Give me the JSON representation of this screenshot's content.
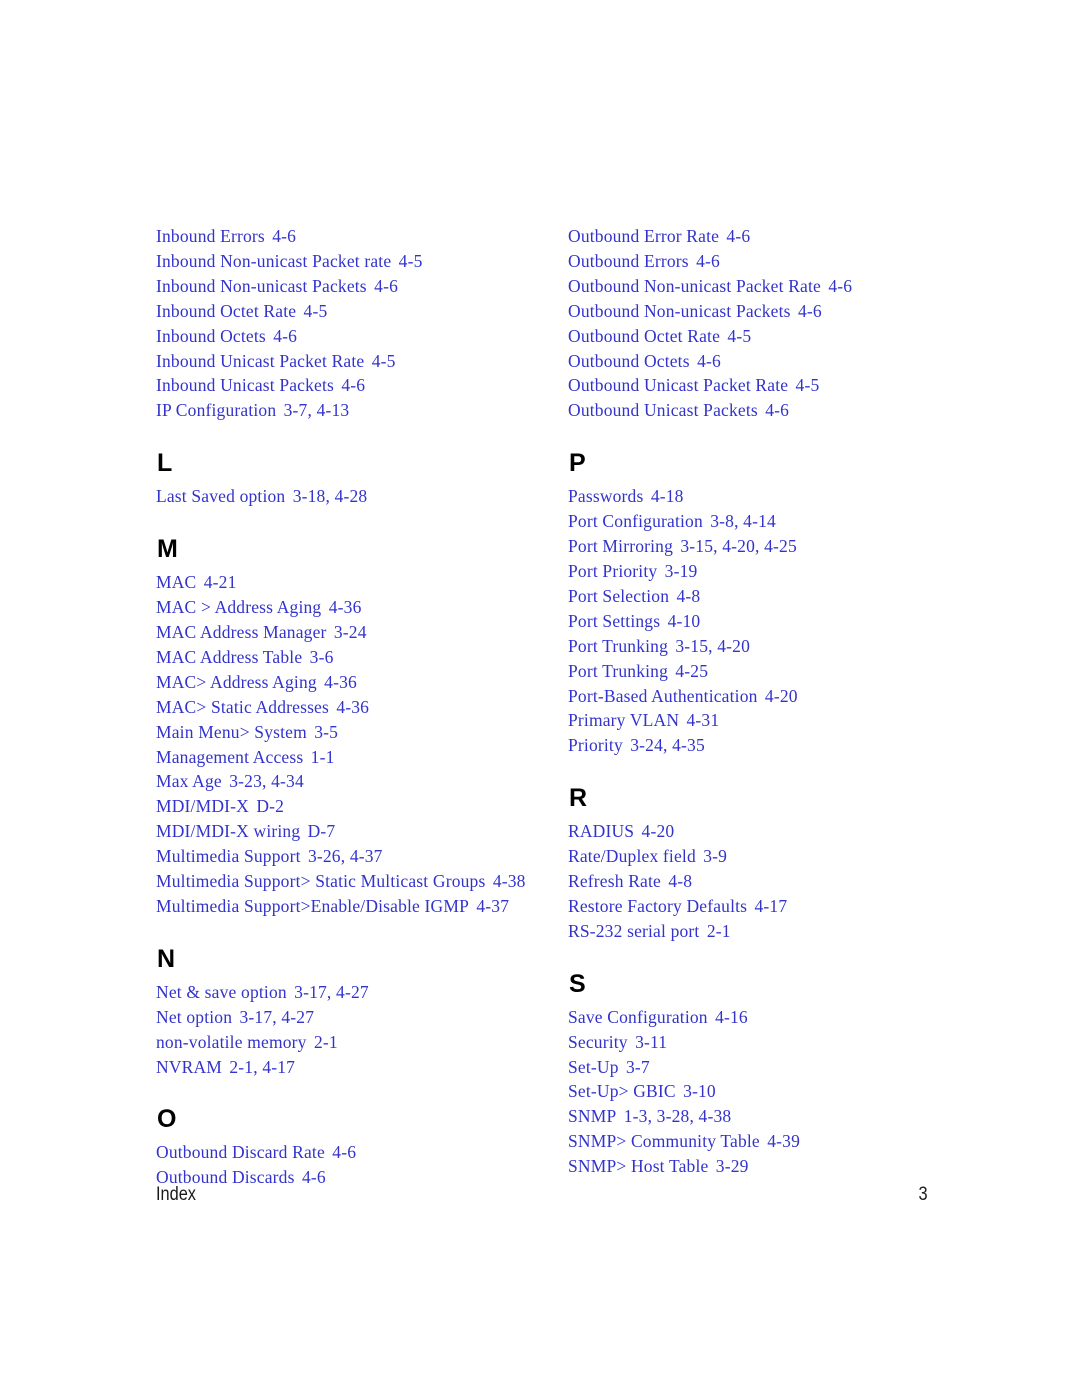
{
  "document": {
    "type": "index",
    "footer": {
      "label": "Index",
      "page_number": "3"
    },
    "text_color": "#3333cc",
    "heading_color": "#000000"
  },
  "columns": [
    {
      "name": "left",
      "sections": [
        {
          "letter": "",
          "entries": [
            {
              "term": "Inbound Errors",
              "loc": "4-6"
            },
            {
              "term": "Inbound Non-unicast Packet rate",
              "loc": "4-5"
            },
            {
              "term": "Inbound Non-unicast Packets",
              "loc": "4-6"
            },
            {
              "term": "Inbound Octet Rate",
              "loc": "4-5"
            },
            {
              "term": "Inbound Octets",
              "loc": "4-6"
            },
            {
              "term": "Inbound Unicast Packet Rate",
              "loc": "4-5"
            },
            {
              "term": "Inbound Unicast Packets",
              "loc": "4-6"
            },
            {
              "term": "IP Configuration",
              "loc": "3-7, 4-13"
            }
          ]
        },
        {
          "letter": "L",
          "entries": [
            {
              "term": "Last Saved option",
              "loc": "3-18, 4-28"
            }
          ]
        },
        {
          "letter": "M",
          "entries": [
            {
              "term": "MAC",
              "loc": "4-21"
            },
            {
              "term": "MAC > Address Aging",
              "loc": "4-36"
            },
            {
              "term": "MAC Address Manager",
              "loc": "3-24"
            },
            {
              "term": "MAC Address Table",
              "loc": "3-6"
            },
            {
              "term": "MAC> Address Aging",
              "loc": "4-36"
            },
            {
              "term": "MAC> Static Addresses",
              "loc": "4-36"
            },
            {
              "term": "Main Menu> System",
              "loc": "3-5"
            },
            {
              "term": "Management Access",
              "loc": "1-1"
            },
            {
              "term": "Max Age",
              "loc": "3-23, 4-34"
            },
            {
              "term": "MDI/MDI-X",
              "loc": "D-2"
            },
            {
              "term": "MDI/MDI-X wiring",
              "loc": "D-7"
            },
            {
              "term": "Multimedia Support",
              "loc": "3-26, 4-37"
            },
            {
              "term": "Multimedia Support> Static Multicast Groups",
              "loc": "4-38"
            },
            {
              "term": "Multimedia Support>Enable/Disable IGMP",
              "loc": "4-37"
            }
          ]
        },
        {
          "letter": "N",
          "entries": [
            {
              "term": "Net & save option",
              "loc": "3-17, 4-27"
            },
            {
              "term": "Net option",
              "loc": "3-17, 4-27"
            },
            {
              "term": "non-volatile memory",
              "loc": "2-1"
            },
            {
              "term": "NVRAM",
              "loc": "2-1, 4-17"
            }
          ]
        },
        {
          "letter": "O",
          "entries": [
            {
              "term": "Outbound Discard Rate",
              "loc": "4-6"
            },
            {
              "term": "Outbound Discards",
              "loc": "4-6"
            }
          ]
        }
      ]
    },
    {
      "name": "right",
      "sections": [
        {
          "letter": "",
          "entries": [
            {
              "term": "Outbound Error Rate",
              "loc": "4-6"
            },
            {
              "term": "Outbound Errors",
              "loc": "4-6"
            },
            {
              "term": "Outbound Non-unicast Packet Rate",
              "loc": "4-6"
            },
            {
              "term": "Outbound Non-unicast Packets",
              "loc": "4-6"
            },
            {
              "term": "Outbound Octet Rate",
              "loc": "4-5"
            },
            {
              "term": "Outbound Octets",
              "loc": "4-6"
            },
            {
              "term": "Outbound Unicast Packet Rate",
              "loc": "4-5"
            },
            {
              "term": "Outbound Unicast Packets",
              "loc": "4-6"
            }
          ]
        },
        {
          "letter": "P",
          "entries": [
            {
              "term": "Passwords",
              "loc": "4-18"
            },
            {
              "term": "Port Configuration",
              "loc": "3-8, 4-14"
            },
            {
              "term": "Port Mirroring",
              "loc": "3-15, 4-20, 4-25"
            },
            {
              "term": "Port Priority",
              "loc": "3-19"
            },
            {
              "term": "Port Selection",
              "loc": "4-8"
            },
            {
              "term": "Port Settings",
              "loc": "4-10"
            },
            {
              "term": "Port Trunking",
              "loc": "3-15, 4-20"
            },
            {
              "term": "Port Trunking",
              "loc": "4-25"
            },
            {
              "term": "Port-Based Authentication",
              "loc": "4-20"
            },
            {
              "term": "Primary VLAN",
              "loc": "4-31"
            },
            {
              "term": "Priority",
              "loc": "3-24, 4-35"
            }
          ]
        },
        {
          "letter": "R",
          "entries": [
            {
              "term": "RADIUS",
              "loc": "4-20"
            },
            {
              "term": "Rate/Duplex field",
              "loc": "3-9"
            },
            {
              "term": "Refresh Rate",
              "loc": "4-8"
            },
            {
              "term": "Restore Factory Defaults",
              "loc": "4-17"
            },
            {
              "term": "RS-232 serial port",
              "loc": "2-1"
            }
          ]
        },
        {
          "letter": "S",
          "entries": [
            {
              "term": "Save Configuration",
              "loc": "4-16"
            },
            {
              "term": "Security",
              "loc": "3-11"
            },
            {
              "term": "Set-Up",
              "loc": "3-7"
            },
            {
              "term": "Set-Up> GBIC",
              "loc": "3-10"
            },
            {
              "term": "SNMP",
              "loc": "1-3, 3-28, 4-38"
            },
            {
              "term": "SNMP> Community Table",
              "loc": "4-39"
            },
            {
              "term": "SNMP> Host Table",
              "loc": "3-29"
            }
          ]
        }
      ]
    }
  ]
}
